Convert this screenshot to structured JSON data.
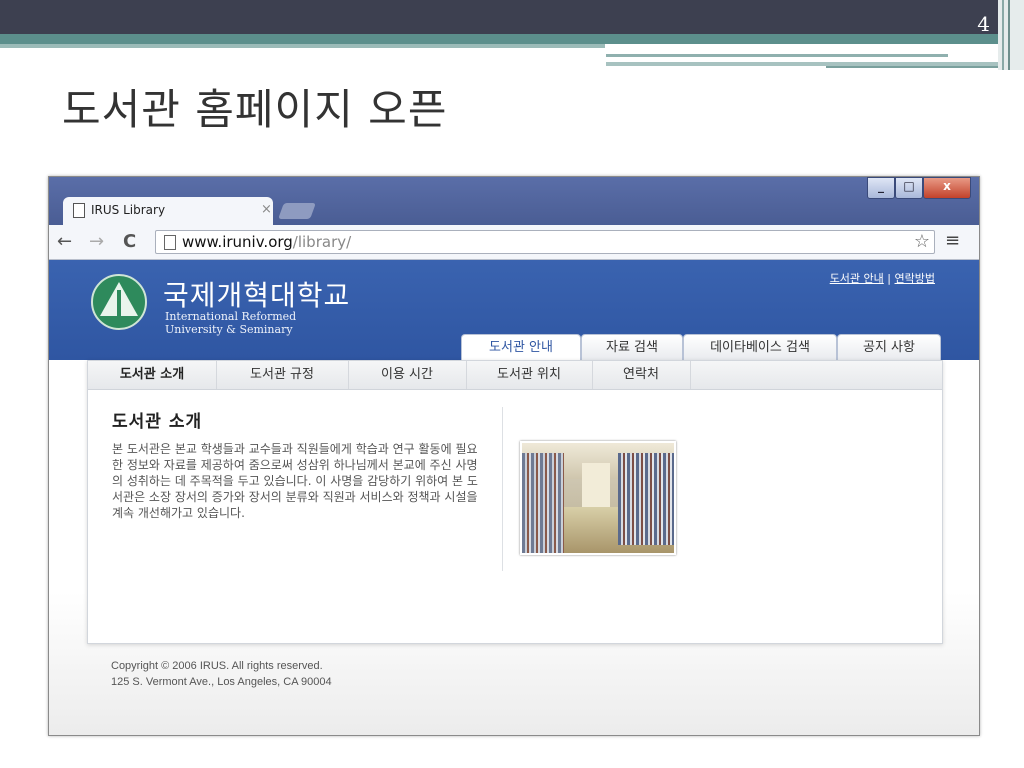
{
  "slide": {
    "number": "4",
    "title": "도서관 홈페이지 오픈"
  },
  "browser": {
    "tab_title": "IRUS Library",
    "tab_close": "×",
    "url_host": "www.iruniv.org",
    "url_path": "/library/",
    "nav_back": "←",
    "nav_forward": "→",
    "nav_reload": "C",
    "star": "☆",
    "menu": "≡",
    "win_min": "_",
    "win_max": "□",
    "win_close": "x"
  },
  "site": {
    "logo_korean": "국제개혁대학교",
    "logo_english_line1": "International Reformed",
    "logo_english_line2": "University  & Seminary",
    "util_link_1": "도서관 안내",
    "util_separator": "|",
    "util_link_2": "연락방법",
    "main_tabs": [
      {
        "label": "도서관 안내"
      },
      {
        "label": "자료 검색"
      },
      {
        "label": "데이타베이스 검색"
      },
      {
        "label": "공지 사항"
      }
    ],
    "subnav": [
      {
        "label": "도서관 소개"
      },
      {
        "label": "도서관 규정"
      },
      {
        "label": "이용 시간"
      },
      {
        "label": "도서관 위치"
      },
      {
        "label": "연락처"
      }
    ],
    "section_title": "도서관 소개",
    "body_text": "본 도서관은 본교 학생들과 교수들과 직원들에게 학습과 연구 활동에 필요한 정보와 자료를 제공하여 줌으로써 성삼위 하나님께서 본교에 주신 사명의 성취하는 데 주목적을 두고 있습니다. 이 사명을 감당하기 위하여 본 도서관은 소장 장서의 증가와 장서의 분류와 직원과 서비스와 정책과 시설을 계속 개선해가고 있습니다.",
    "footer_line1": "Copyright © 2006 IRUS. All rights reserved.",
    "footer_line2": "125 S. Vermont Ave., Los Angeles, CA 90004"
  }
}
